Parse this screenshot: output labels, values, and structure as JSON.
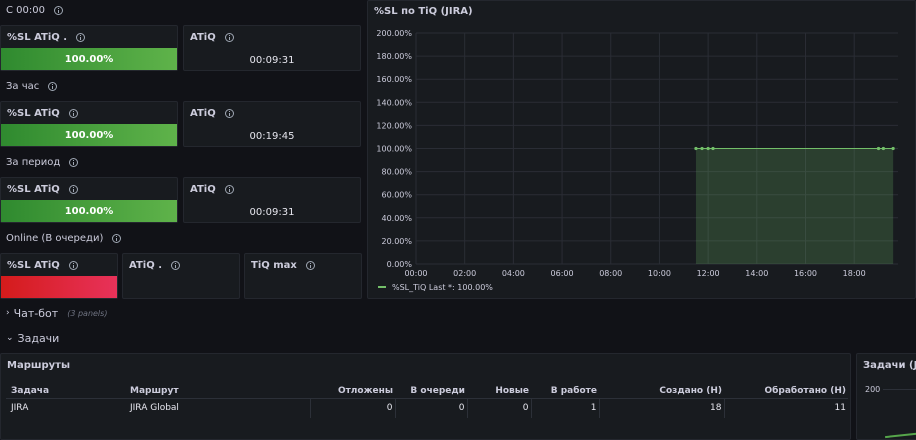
{
  "rows": {
    "since": "С 00:00",
    "hour": "За час",
    "period": "За период",
    "online": "Online (В очереди)"
  },
  "panels": {
    "since_sl": {
      "title": "%SL ATiQ .",
      "value": "100.00%"
    },
    "since_atiq": {
      "title": "ATiQ",
      "value": "00:09:31"
    },
    "hour_sl": {
      "title": "%SL ATiQ",
      "value": "100.00%"
    },
    "hour_atiq": {
      "title": "ATiQ",
      "value": "00:19:45"
    },
    "period_sl": {
      "title": "%SL ATiQ",
      "value": "100.00%"
    },
    "period_atiq": {
      "title": "ATiQ",
      "value": "00:09:31"
    },
    "online_sl": {
      "title": "%SL ATiQ",
      "value": ""
    },
    "online_atiq": {
      "title": "ATiQ .",
      "value": ""
    },
    "online_tiq": {
      "title": "TiQ max",
      "value": ""
    }
  },
  "colors": {
    "ok": "#56a64b",
    "bad": "#e02f44",
    "series": "#73bf69"
  },
  "chart_data": {
    "type": "area",
    "title": "%SL по TiQ (JIRA)",
    "x_ticks": [
      "00:00",
      "02:00",
      "04:00",
      "06:00",
      "08:00",
      "10:00",
      "12:00",
      "14:00",
      "16:00",
      "18:00"
    ],
    "y_ticks": [
      "0.00%",
      "20.00%",
      "40.00%",
      "60.00%",
      "80.00%",
      "100.00%",
      "120.00%",
      "140.00%",
      "160.00%",
      "180.00%",
      "200.00%"
    ],
    "ylim": [
      0,
      200
    ],
    "xlim_hours": [
      0,
      19.8
    ],
    "series": [
      {
        "name": "%SL_TiQ",
        "x_hours": [
          11.5,
          11.75,
          12.0,
          12.2,
          19.0,
          19.2,
          19.6
        ],
        "values": [
          100,
          100,
          100,
          100,
          100,
          100,
          100
        ]
      }
    ],
    "legend": {
      "text": "%SL_TiQ  Last *: 100.00%",
      "placement": "bottom-left"
    }
  },
  "sections": [
    {
      "name": "Чат-бот",
      "sub": "(3 panels)",
      "chev": "›"
    },
    {
      "name": "Задачи",
      "sub": "",
      "chev": "⌄"
    }
  ],
  "routes": {
    "title": "Маршруты",
    "columns": [
      "Задача",
      "Маршрут",
      "Отложены",
      "В очереди",
      "Новые",
      "В работе",
      "Создано (Н)",
      "Обработано (Н)"
    ],
    "rows": [
      [
        "JIRA",
        "JIRA Global",
        "0",
        "0",
        "0",
        "1",
        "18",
        "11"
      ]
    ]
  },
  "tasks_panel": {
    "title": "Задачи (JIR",
    "y_tick": "200"
  }
}
